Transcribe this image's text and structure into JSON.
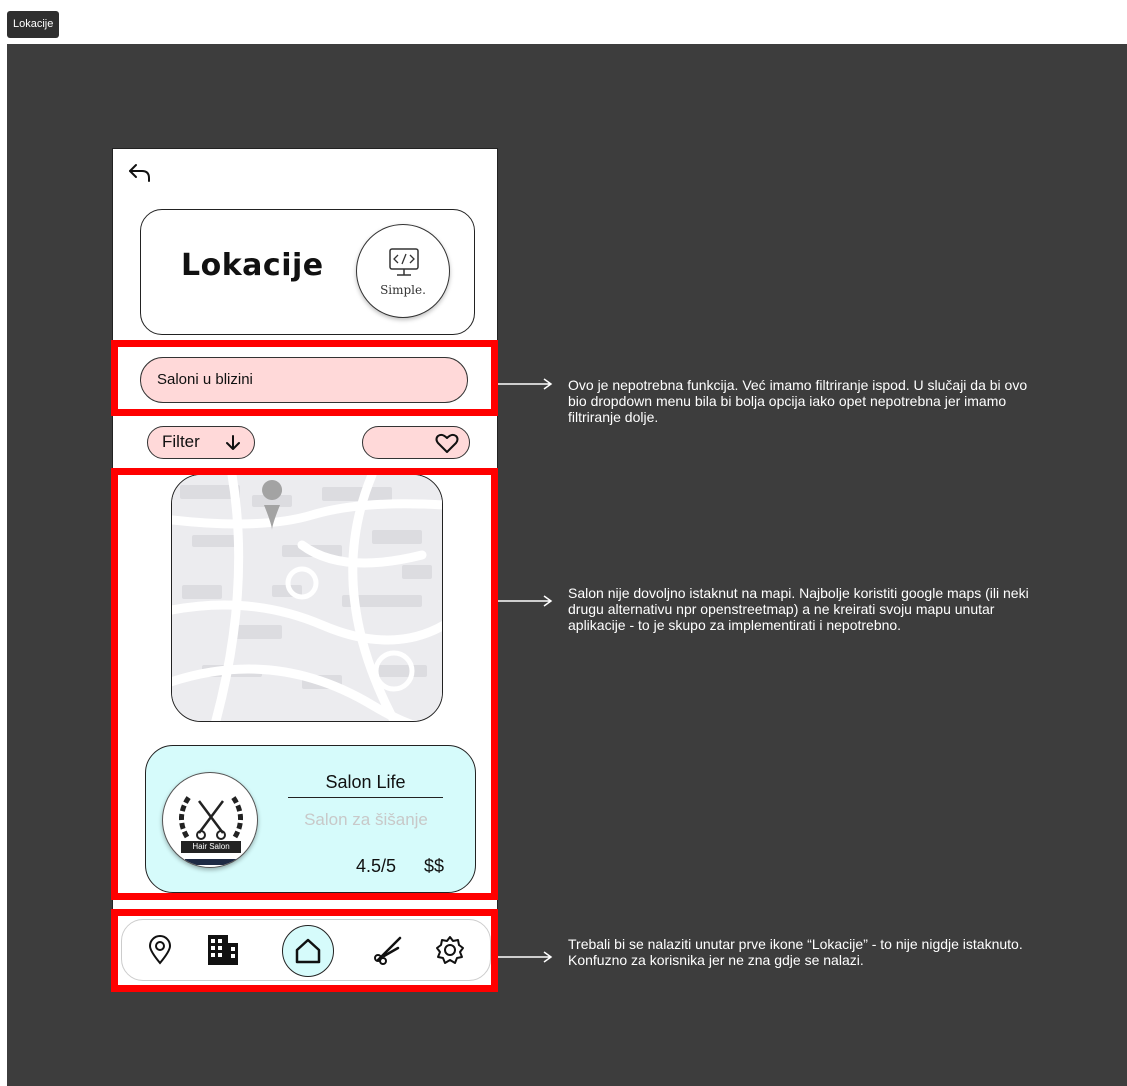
{
  "frame": {
    "label": "Lokacije"
  },
  "header": {
    "title": "Lokacije",
    "logo_text": "Simple."
  },
  "search": {
    "label": "Saloni u blizini"
  },
  "filter": {
    "label": "Filter"
  },
  "salon": {
    "name": "Salon Life",
    "type": "Salon za šišanje",
    "rating": "4.5/5",
    "price": "$$",
    "badge_text": "Hair Salon"
  },
  "notes": [
    "Ovo je nepotrebna funkcija. Već imamo filtriranje ispod. U slučaji da bi ovo bio dropdown menu bila bi bolja opcija iako opet nepotrebna jer imamo filtriranje dolje.",
    "Salon nije dovoljno istaknut na mapi. Najbolje koristiti google maps (ili neki drugu alternativu npr openstreetmap) a ne kreirati svoju mapu unutar aplikacije - to je skupo za implementirati i nepotrebno.",
    "Trebali bi se nalaziti unutar prve ikone “Lokacije” - to nije nigdje istaknuto. Konfuzno za korisnika jer ne zna gdje se nalazi."
  ],
  "nav": {
    "icons": [
      "location-pin-icon",
      "building-icon",
      "home-icon",
      "scissors-icon",
      "settings-icon"
    ]
  },
  "colors": {
    "canvas": "#3d3d3d",
    "highlight": "#ff0000",
    "pill": "#ffd9d9",
    "card": "#d6fbfb"
  }
}
